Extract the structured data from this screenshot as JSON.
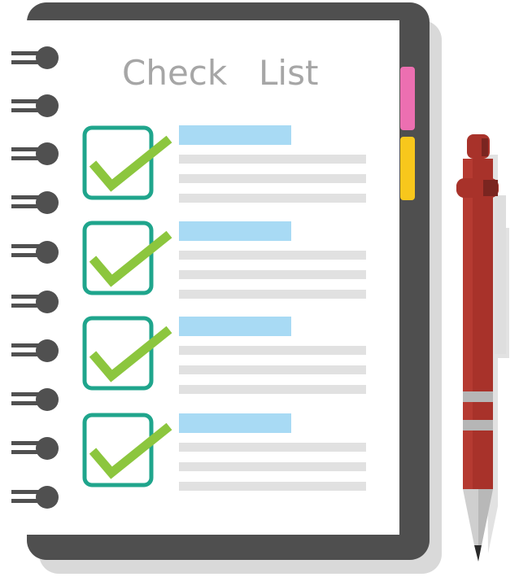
{
  "notebook": {
    "title_word_1": "Check",
    "title_word_2": "List",
    "items_checked": [
      true,
      true,
      true,
      true
    ]
  },
  "colors": {
    "cover": "#4f4f4f",
    "cover_shadow": "#d9d9d9",
    "page": "#ffffff",
    "checkbox_border": "#1fa58c",
    "checkmark": "#8cc63e",
    "heading_bar": "#a8daf4",
    "text_line": "#e1e1e1",
    "tab_pink": "#ec6fb1",
    "tab_yellow": "#f8c71c",
    "ring": "#505050",
    "pen_body": "#a8322a",
    "pen_cap": "#7a2520",
    "pen_band": "#b6b6b6",
    "pen_tip": "#cfcfcf"
  },
  "icons": [
    "spiral-ring-icon",
    "checkbox-icon",
    "checkmark-icon",
    "pen-icon",
    "notebook-tab-icon"
  ]
}
